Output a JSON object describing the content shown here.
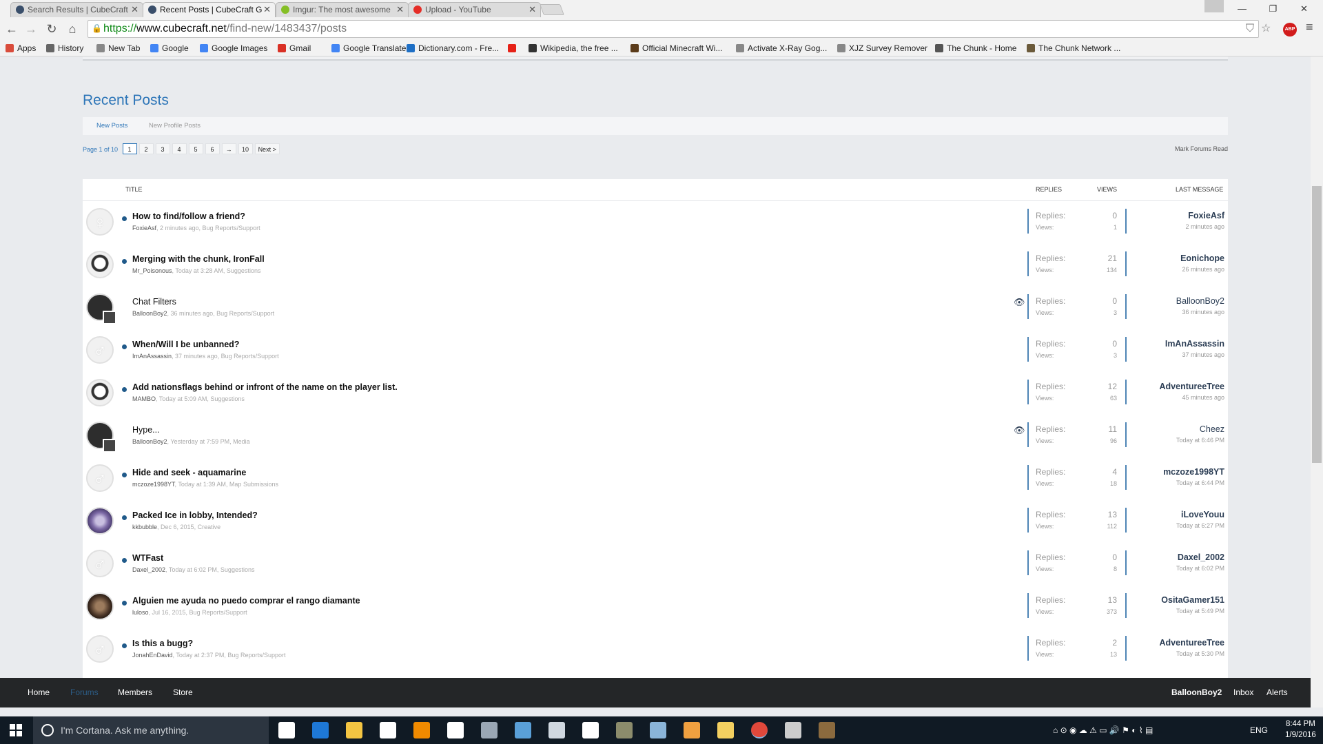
{
  "browser": {
    "tabs": [
      {
        "title": "Search Results | CubeCraft",
        "fav_color": "#3a4f6b"
      },
      {
        "title": "Recent Posts | CubeCraft G",
        "fav_color": "#3a4f6b"
      },
      {
        "title": "Imgur: The most awesome",
        "fav_color": "#85bf25"
      },
      {
        "title": "Upload - YouTube",
        "fav_color": "#e52d27"
      }
    ],
    "tab_close": "✕",
    "window": {
      "minimize": "—",
      "restore": "❐",
      "close": "✕"
    },
    "url": {
      "protocol": "https://",
      "host": "www.cubecraft.net",
      "path": "/find-new/1483437/posts"
    },
    "abp": "ABP",
    "bookmarks": [
      {
        "label": "Apps",
        "color": "#d94c3b"
      },
      {
        "label": "History",
        "color": "#666666"
      },
      {
        "label": "New Tab",
        "color": "#888888"
      },
      {
        "label": "Google",
        "color": "#4285f4"
      },
      {
        "label": "Google Images",
        "color": "#4285f4"
      },
      {
        "label": "Gmail",
        "color": "#d93025"
      },
      {
        "label": "Google Translate",
        "color": "#4285f4"
      },
      {
        "label": "Dictionary.com - Fre...",
        "color": "#1e6fc5"
      },
      {
        "label": "",
        "color": "#e62117"
      },
      {
        "label": "Wikipedia, the free ...",
        "color": "#333333"
      },
      {
        "label": "Official Minecraft Wi...",
        "color": "#5b3b1a"
      },
      {
        "label": "Activate X-Ray Gog...",
        "color": "#888888"
      },
      {
        "label": "XJZ Survey Remover",
        "color": "#888888"
      },
      {
        "label": "The Chunk - Home",
        "color": "#555555"
      },
      {
        "label": "The Chunk Network ...",
        "color": "#6b5a3a"
      }
    ]
  },
  "forum": {
    "page_title": "Recent Posts",
    "subtabs": [
      "New Posts",
      "New Profile Posts"
    ],
    "pager": {
      "label": "Page 1 of 10",
      "pages": [
        "1",
        "2",
        "3",
        "4",
        "5",
        "6",
        "→",
        "10",
        "Next >"
      ]
    },
    "mark_read": "Mark Forums Read",
    "columns": {
      "title": "TITLE",
      "replies": "REPLIES",
      "views": "VIEWS",
      "last": "LAST MESSAGE"
    },
    "stat_labels": {
      "replies": "Replies:",
      "views": "Views:"
    },
    "threads": [
      {
        "title": "How to find/follow a friend?",
        "unread": true,
        "author": "FoxieAsf",
        "meta": ", 2 minutes ago, Bug Reports/Support",
        "replies": "0",
        "views": "1",
        "last_user": "FoxieAsf",
        "last_time": "2 minutes ago",
        "avatar": "female",
        "watched": false
      },
      {
        "title": "Merging with the chunk, IronFall",
        "unread": true,
        "author": "Mr_Poisonous",
        "meta": ", Today at 3:28 AM, Suggestions",
        "replies": "21",
        "views": "134",
        "last_user": "Eonichope",
        "last_time": "26 minutes ago",
        "avatar": "pic",
        "watched": false
      },
      {
        "title": "Chat Filters",
        "unread": false,
        "author": "BalloonBoy2",
        "meta": ", 36 minutes ago, Bug Reports/Support",
        "replies": "0",
        "views": "3",
        "last_user": "BalloonBoy2",
        "last_time": "36 minutes ago",
        "avatar": "dark",
        "watched": true
      },
      {
        "title": "When/Will I be unbanned?",
        "unread": true,
        "author": "ImAnAssassin",
        "meta": ", 37 minutes ago, Bug Reports/Support",
        "replies": "0",
        "views": "3",
        "last_user": "ImAnAssassin",
        "last_time": "37 minutes ago",
        "avatar": "male",
        "watched": false
      },
      {
        "title": "Add nationsflags behind or infront of the name on the player list.",
        "unread": true,
        "author": "MAMBO",
        "meta": ", Today at 5:09 AM, Suggestions",
        "replies": "12",
        "views": "63",
        "last_user": "AdventureeTree",
        "last_time": "45 minutes ago",
        "avatar": "pic",
        "watched": false
      },
      {
        "title": "Hype...",
        "unread": false,
        "author": "BalloonBoy2",
        "meta": ", Yesterday at 7:59 PM, Media",
        "replies": "11",
        "views": "96",
        "last_user": "Cheez",
        "last_time": "Today at 6:46 PM",
        "avatar": "dark",
        "watched": true
      },
      {
        "title": "Hide and seek - aquamarine",
        "unread": true,
        "author": "mczoze1998YT",
        "meta": ", Today at 1:39 AM, Map Submissions",
        "replies": "4",
        "views": "18",
        "last_user": "mczoze1998YT",
        "last_time": "Today at 6:44 PM",
        "avatar": "male",
        "watched": false
      },
      {
        "title": "Packed Ice in lobby, Intended?",
        "unread": true,
        "author": "kkbubble",
        "meta": ", Dec 6, 2015, Creative",
        "replies": "13",
        "views": "112",
        "last_user": "iLoveYouu",
        "last_time": "Today at 6:27 PM",
        "avatar": "purple",
        "watched": false
      },
      {
        "title": "WTFast",
        "unread": true,
        "author": "Daxel_2002",
        "meta": ", Today at 6:02 PM, Suggestions",
        "replies": "0",
        "views": "8",
        "last_user": "Daxel_2002",
        "last_time": "Today at 6:02 PM",
        "avatar": "male",
        "watched": false
      },
      {
        "title": "Alguien me ayuda no puedo comprar el rango diamante",
        "unread": true,
        "author": "luloso",
        "meta": ", Jul 16, 2015, Bug Reports/Support",
        "replies": "13",
        "views": "373",
        "last_user": "OsitaGamer151",
        "last_time": "Today at 5:49 PM",
        "avatar": "brown",
        "watched": false
      },
      {
        "title": "Is this a bugg?",
        "unread": true,
        "author": "JonahEnDavid",
        "meta": ", Today at 2:37 PM, Bug Reports/Support",
        "replies": "2",
        "views": "13",
        "last_user": "AdventureeTree",
        "last_time": "Today at 5:30 PM",
        "avatar": "male",
        "watched": false
      }
    ]
  },
  "footer": {
    "nav": [
      "Home",
      "Forums",
      "Members",
      "Store"
    ],
    "user": "BalloonBoy2",
    "inbox": "Inbox",
    "alerts": "Alerts"
  },
  "taskbar": {
    "cortana": "I'm Cortana. Ask me anything.",
    "lang": "ENG",
    "time": "8:44 PM",
    "date": "1/9/2016",
    "apps": [
      {
        "name": "task-view",
        "color": "#ffffff"
      },
      {
        "name": "edge",
        "color": "#1e78d6"
      },
      {
        "name": "file-explorer",
        "color": "#f4c542"
      },
      {
        "name": "store",
        "color": "#ffffff"
      },
      {
        "name": "vlc",
        "color": "#f08a00"
      },
      {
        "name": "home",
        "color": "#ffffff"
      },
      {
        "name": "app-7",
        "color": "#9aa7b5"
      },
      {
        "name": "app-8",
        "color": "#5aa0d8"
      },
      {
        "name": "app-9",
        "color": "#d0d8e0"
      },
      {
        "name": "calculator",
        "color": "#ffffff"
      },
      {
        "name": "app-11",
        "color": "#8c8c6c"
      },
      {
        "name": "app-12",
        "color": "#8ab4d8"
      },
      {
        "name": "app-13",
        "color": "#f0a040"
      },
      {
        "name": "app-14",
        "color": "#f4d060"
      },
      {
        "name": "chrome",
        "color": "#e0483b"
      },
      {
        "name": "app-16",
        "color": "#cccccc"
      },
      {
        "name": "minecraft",
        "color": "#8b6a3e"
      }
    ]
  }
}
